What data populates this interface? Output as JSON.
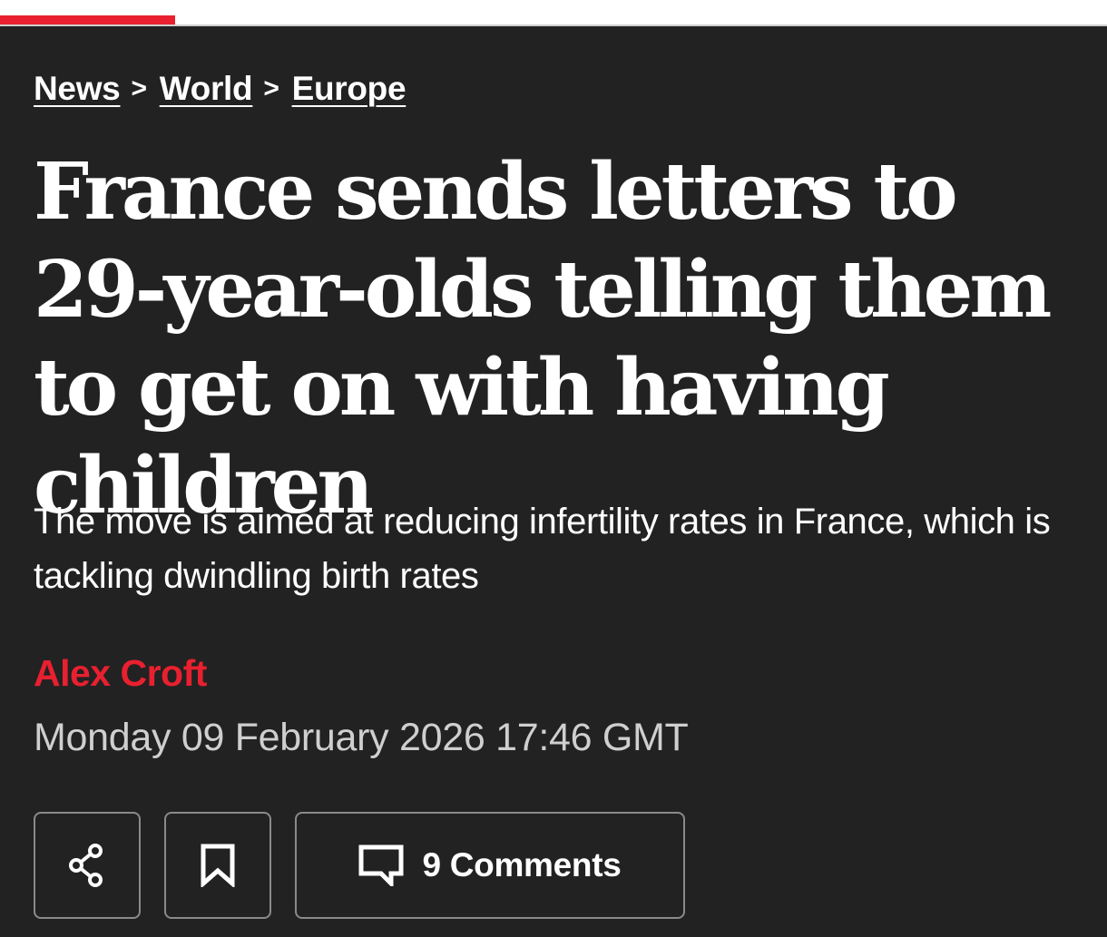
{
  "breadcrumb": {
    "items": [
      "News",
      "World",
      "Europe"
    ],
    "separator": ">"
  },
  "article": {
    "headline": "France sends letters to 29-year-olds telling them to get on with having children",
    "standfirst": "The move is aimed at reducing infertility rates in France, which is tackling dwindling birth rates",
    "author": "Alex Croft",
    "dateline": "Monday 09 February 2026 17:46 GMT"
  },
  "actions": {
    "share_icon": "share-icon",
    "bookmark_icon": "bookmark-icon",
    "comment_icon": "comment-icon",
    "comments_label": "9 Comments"
  },
  "reading_progress": 0.158,
  "colors": {
    "background": "#222222",
    "accent": "#e8202f",
    "text": "#ffffff",
    "meta_text": "#cfcfcf",
    "button_border": "#8a8a8a"
  }
}
